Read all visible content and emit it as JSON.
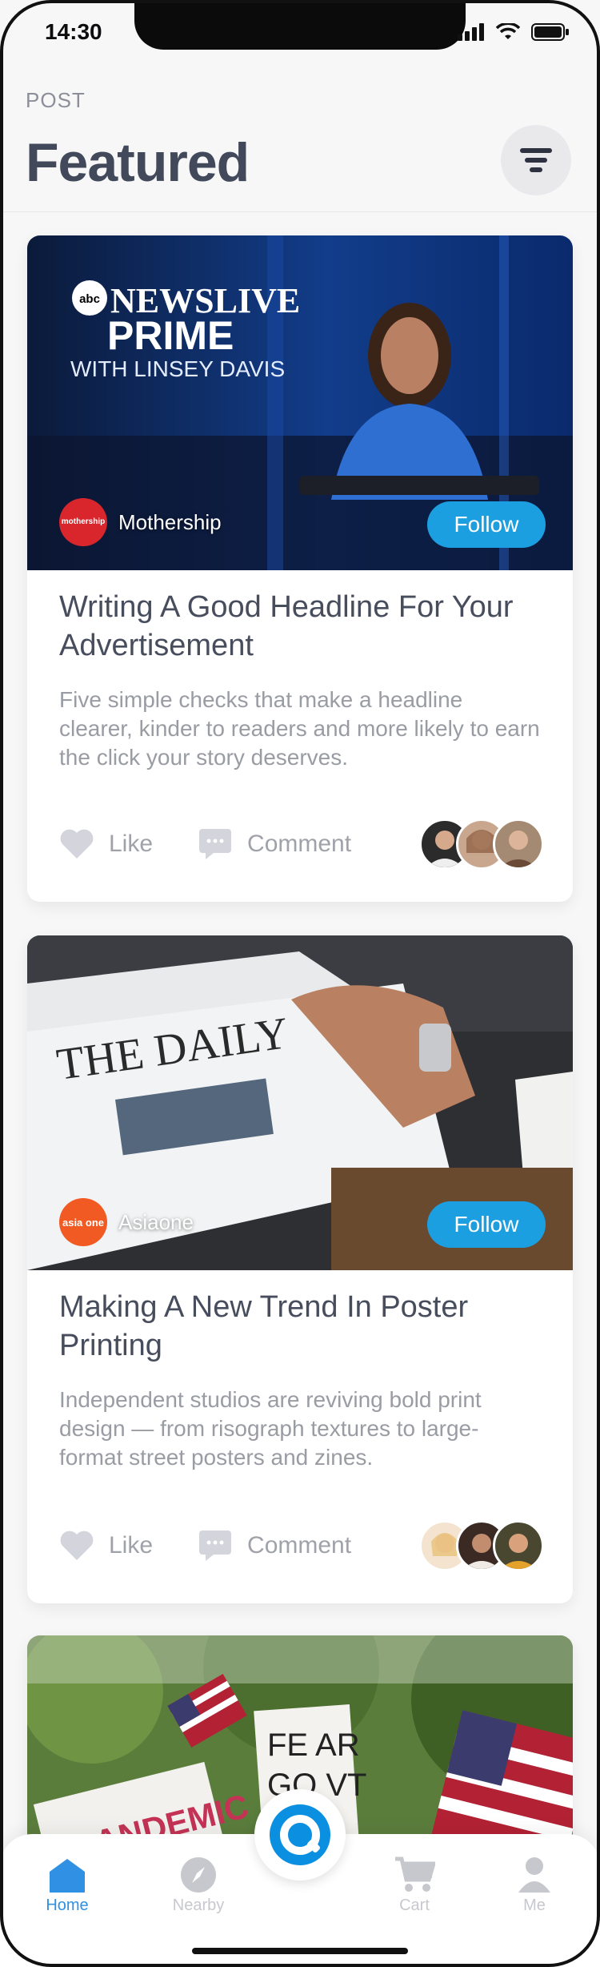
{
  "status": {
    "time": "14:30"
  },
  "header": {
    "section": "POST",
    "title": "Featured"
  },
  "posts": [
    {
      "source": "Mothership",
      "source_logo_text": "mothership",
      "follow_label": "Follow",
      "image_text": {
        "line1": "NEWSLIVE",
        "line2": "PRIME",
        "line3": "WITH LINSEY DAVIS",
        "brand": "abc"
      },
      "title": "Writing A Good Headline For Your Advertisement",
      "description": "Five simple checks that make a headline clearer, kinder to readers and more likely to earn the click your story deserves.",
      "like_label": "Like",
      "comment_label": "Comment"
    },
    {
      "source": "Asiaone",
      "source_logo_text": "asia one",
      "follow_label": "Follow",
      "image_text": {
        "masthead": "THE DAILY"
      },
      "title": "Making A New Trend In Poster Printing",
      "description": "Independent studios are reviving bold print design — from risograph textures to large-format street posters and zines.",
      "like_label": "Like",
      "comment_label": "Comment"
    },
    {
      "image_text": {
        "sign1": "FE AR",
        "sign2": "GO VT",
        "sign3": "PLANDEMIC"
      }
    }
  ],
  "tabs": [
    {
      "label": "Home",
      "icon": "home-icon",
      "active": true
    },
    {
      "label": "Nearby",
      "icon": "compass-icon",
      "active": false
    },
    {
      "label": "Cart",
      "icon": "cart-icon",
      "active": false
    },
    {
      "label": "Me",
      "icon": "person-icon",
      "active": false
    }
  ],
  "colors": {
    "accent": "#1c9fe0",
    "tab_active": "#2f90e4",
    "title": "#41495a"
  }
}
